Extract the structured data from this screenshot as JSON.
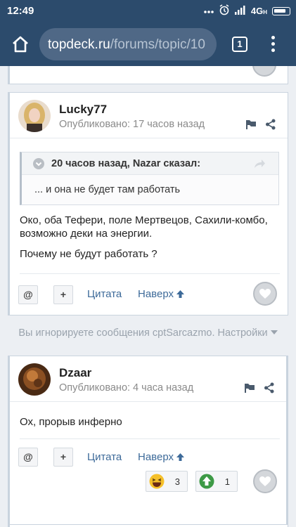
{
  "status_bar": {
    "time": "12:49",
    "network": "4G",
    "network_sub": "H"
  },
  "browser": {
    "url_host": "topdeck.ru",
    "url_path": "/forums/topic/10",
    "tab_count": "1"
  },
  "posts": [
    {
      "author": "Lucky77",
      "posted": "Опубликовано: 17 часов назад",
      "quote": {
        "cite": "20 часов назад, Nazar сказал:",
        "text": "... и она не будет там работать"
      },
      "paragraphs": [
        "Око, оба Тефери, поле Мертвецов, Сахили-комбо, возможно деки на энергии.",
        "Почему не будут работать ?"
      ],
      "mention_label": "@",
      "plus_label": "+",
      "quote_label": "Цитата",
      "top_label": "Наверх"
    },
    {
      "author": "Dzaar",
      "posted": "Опубликовано: 4 часа назад",
      "paragraphs": [
        "Ох, прорыв инферно"
      ],
      "mention_label": "@",
      "plus_label": "+",
      "quote_label": "Цитата",
      "top_label": "Наверх",
      "reactions": [
        {
          "icon": "laughing-emoji-icon",
          "count": "3"
        },
        {
          "icon": "upvote-icon",
          "count": "1"
        }
      ]
    }
  ],
  "ignored_notice": "Вы игнорируете сообщения cptSarcazmo. Настройки",
  "colors": {
    "header_bg": "#2c4b6c",
    "link": "#3d6a99",
    "muted_text": "#8a8a8a",
    "upvote_green": "#3d9a46"
  }
}
